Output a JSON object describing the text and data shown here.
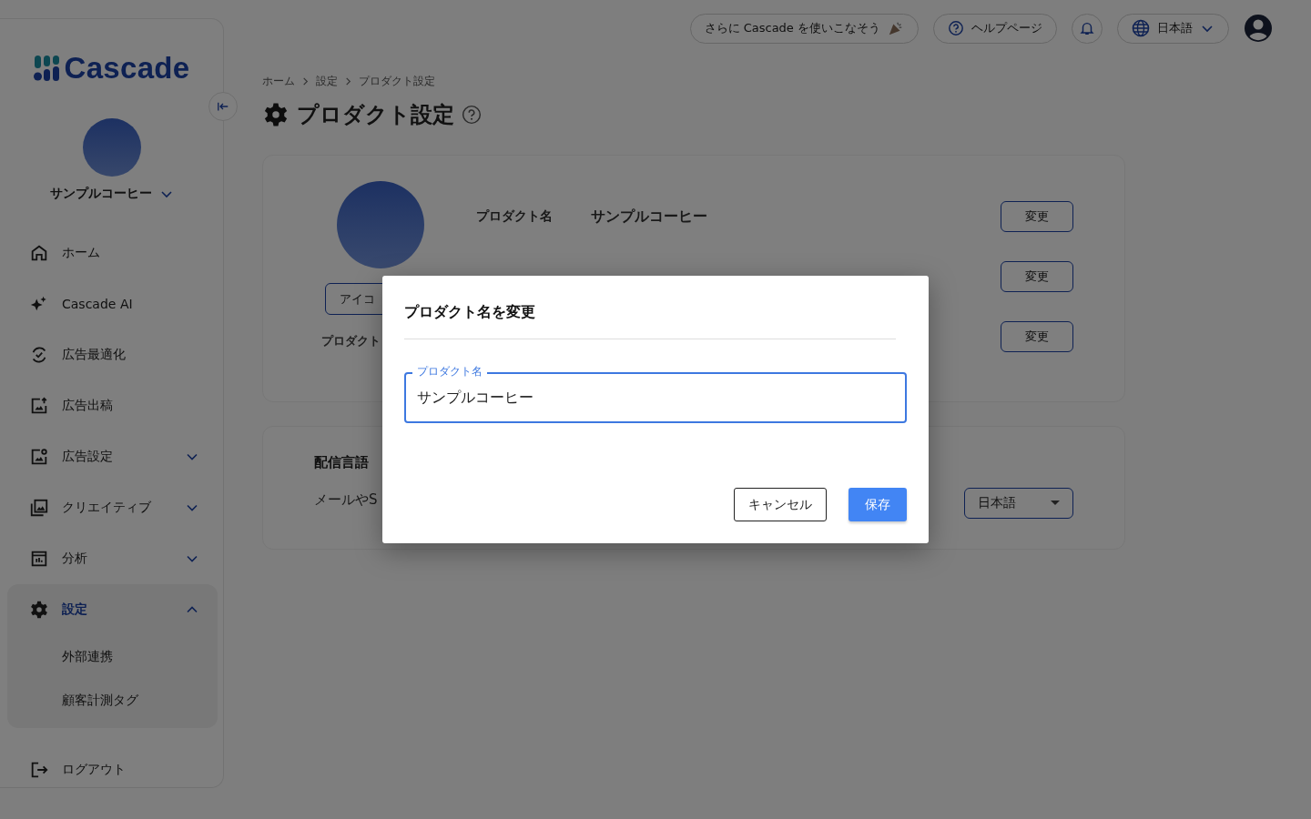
{
  "header": {
    "promo": "さらに Cascade を使いこなそう",
    "help": "ヘルプページ",
    "language": "日本語"
  },
  "sidebar": {
    "logo": "Cascade",
    "product": "サンプルコーヒー",
    "items": [
      {
        "label": "ホーム",
        "selected": false
      },
      {
        "label": "Cascade AI",
        "selected": false
      },
      {
        "label": "広告最適化",
        "selected": false
      },
      {
        "label": "広告出稿",
        "selected": false
      },
      {
        "label": "広告設定",
        "selected": false,
        "expanded": false
      },
      {
        "label": "クリエイティブ",
        "selected": false,
        "expanded": false
      },
      {
        "label": "分析",
        "selected": false,
        "expanded": false
      },
      {
        "label": "設定",
        "selected": true,
        "expanded": true,
        "children": [
          {
            "label": "外部連携",
            "selected": false
          },
          {
            "label": "顧客計測タグ",
            "selected": false
          }
        ]
      },
      {
        "label": "ログアウト",
        "selected": false
      }
    ]
  },
  "breadcrumb": [
    "ホーム",
    "設定",
    "プロダクト設定"
  ],
  "page_title": "プロダクト設定",
  "product_card": {
    "icon_button": "アイコ",
    "icon_caption": "プロダクト",
    "rows": [
      {
        "label": "プロダクト名",
        "value": "サンプルコーヒー",
        "button": "変更"
      },
      {
        "button": "変更"
      },
      {
        "button": "変更"
      }
    ]
  },
  "language_card": {
    "title": "配信言語",
    "description": "メールやS",
    "select": "日本語"
  },
  "dialog": {
    "title": "プロダクト名を変更",
    "field": {
      "label": "プロダクト名",
      "value": "サンプルコーヒー"
    },
    "buttons": [
      {
        "label": "キャンセル",
        "kind": "secondary"
      },
      {
        "label": "保存",
        "kind": "primary"
      }
    ]
  }
}
